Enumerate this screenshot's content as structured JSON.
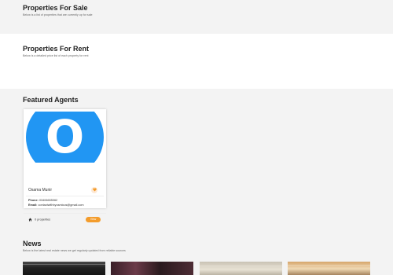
{
  "sale": {
    "title": "Properties For Sale",
    "subtitle": "Below is a list of properties that are currently up for sale"
  },
  "rent": {
    "title": "Properties For Rent",
    "subtitle": "Below is a detailed price list of each property for rent"
  },
  "agents": {
    "title": "Featured Agents",
    "cards": [
      {
        "avatar_letter": "O",
        "avatar_color": "#2196f3",
        "name": "Osama Munir",
        "phone_label": "Phone:",
        "phone": "03406655062",
        "email_label": "Email:",
        "email": "contactwithbyusmicus@gmail.com",
        "properties": "0 properties",
        "view_label": "View"
      }
    ]
  },
  "news": {
    "title": "News",
    "subtitle": "Below is the latest real estate news we get regularly updated from reliable sources"
  },
  "colors": {
    "accent": "#f39c2c",
    "avatar": "#2196f3"
  }
}
